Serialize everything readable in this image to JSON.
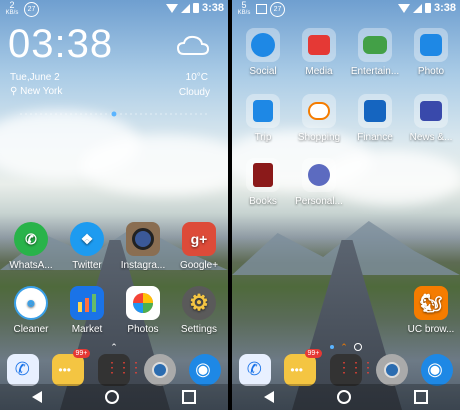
{
  "status": {
    "left_speed": "2",
    "left_unit": "KB/s",
    "badge": "27",
    "time": "3:38",
    "right_speed": "5",
    "right_unit": "KB/s"
  },
  "left_screen": {
    "clock": "03:38",
    "date": "Tue,June 2",
    "location": "New York",
    "temperature": "10°C",
    "condition": "Cloudy",
    "row1": [
      {
        "label": "WhatsA...",
        "icon": "whatsapp-icon",
        "color": "#29b34a"
      },
      {
        "label": "Twitter",
        "icon": "twitter-icon",
        "color": "#1d9bf0"
      },
      {
        "label": "Instagra...",
        "icon": "instagram-icon",
        "color": "#8a6e52"
      },
      {
        "label": "Google+",
        "icon": "google-plus-icon",
        "color": "#dd4b39",
        "glyph": "g+"
      }
    ],
    "row2": [
      {
        "label": "Cleaner",
        "icon": "cleaner-icon",
        "color": "#ffffff"
      },
      {
        "label": "Market",
        "icon": "market-icon",
        "color": "#1a73e8"
      },
      {
        "label": "Photos",
        "icon": "photos-icon",
        "color": "#ffffff"
      },
      {
        "label": "Settings",
        "icon": "settings-icon",
        "color": "#c7a23a"
      }
    ],
    "dock_badge": "99+"
  },
  "right_screen": {
    "row1": [
      {
        "label": "Social",
        "icon": "social-folder-icon"
      },
      {
        "label": "Media",
        "icon": "media-folder-icon"
      },
      {
        "label": "Entertain...",
        "icon": "entertainment-folder-icon"
      },
      {
        "label": "Photo",
        "icon": "photo-folder-icon"
      }
    ],
    "row2": [
      {
        "label": "Trip",
        "icon": "trip-folder-icon"
      },
      {
        "label": "Shopping",
        "icon": "shopping-folder-icon"
      },
      {
        "label": "Finance",
        "icon": "finance-folder-icon"
      },
      {
        "label": "News &...",
        "icon": "news-folder-icon"
      }
    ],
    "row3": [
      {
        "label": "Books",
        "icon": "books-folder-icon"
      },
      {
        "label": "Personal...",
        "icon": "personal-folder-icon"
      }
    ],
    "uc_label": "UC brow...",
    "dock_badge": "99+"
  }
}
